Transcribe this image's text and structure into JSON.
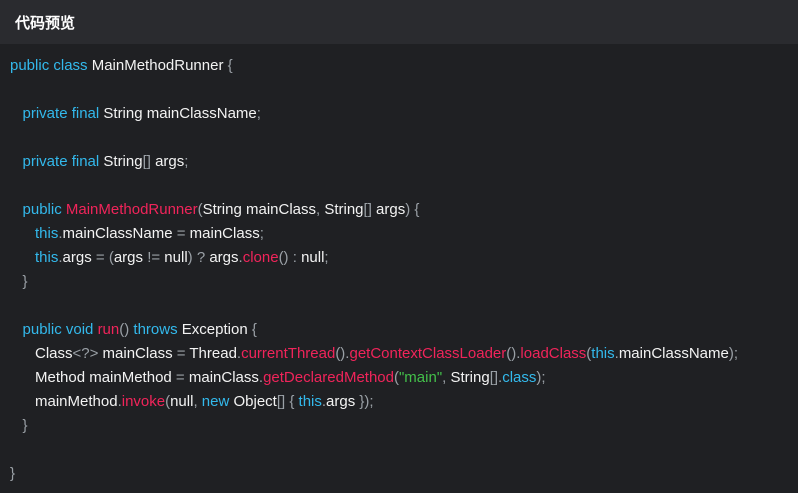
{
  "header": {
    "title": "代码预览"
  },
  "colors": {
    "background": "#1f2023",
    "header_background": "#2a2b2f",
    "keyword": "#33b9ec",
    "function": "#f0245a",
    "string": "#43c04a",
    "punctuation": "#9aa0a6",
    "text": "#f3f3f3"
  },
  "code": {
    "lines": [
      [
        [
          "kw",
          "public class "
        ],
        [
          "tx",
          "MainMethodRunner "
        ],
        [
          "pn",
          "{"
        ]
      ],
      [],
      [
        [
          "tx",
          "   "
        ],
        [
          "kw",
          "private final "
        ],
        [
          "tx",
          "String mainClassName"
        ],
        [
          "pn",
          ";"
        ]
      ],
      [],
      [
        [
          "tx",
          "   "
        ],
        [
          "kw",
          "private final "
        ],
        [
          "tx",
          "String"
        ],
        [
          "pn",
          "[] "
        ],
        [
          "tx",
          "args"
        ],
        [
          "pn",
          ";"
        ]
      ],
      [],
      [
        [
          "tx",
          "   "
        ],
        [
          "kw",
          "public "
        ],
        [
          "fn",
          "MainMethodRunner"
        ],
        [
          "pn",
          "("
        ],
        [
          "tx",
          "String mainClass"
        ],
        [
          "pn",
          ", "
        ],
        [
          "tx",
          "String"
        ],
        [
          "pn",
          "[] "
        ],
        [
          "tx",
          "args"
        ],
        [
          "pn",
          ") {"
        ]
      ],
      [
        [
          "tx",
          "      "
        ],
        [
          "kw",
          "this"
        ],
        [
          "pn",
          "."
        ],
        [
          "tx",
          "mainClassName "
        ],
        [
          "pn",
          "= "
        ],
        [
          "tx",
          "mainClass"
        ],
        [
          "pn",
          ";"
        ]
      ],
      [
        [
          "tx",
          "      "
        ],
        [
          "kw",
          "this"
        ],
        [
          "pn",
          "."
        ],
        [
          "tx",
          "args "
        ],
        [
          "pn",
          "= ("
        ],
        [
          "tx",
          "args "
        ],
        [
          "pn",
          "!= "
        ],
        [
          "tx",
          "null"
        ],
        [
          "pn",
          ") ? "
        ],
        [
          "tx",
          "args"
        ],
        [
          "pn",
          "."
        ],
        [
          "fn",
          "clone"
        ],
        [
          "pn",
          "() : "
        ],
        [
          "tx",
          "null"
        ],
        [
          "pn",
          ";"
        ]
      ],
      [
        [
          "tx",
          "   "
        ],
        [
          "pn",
          "}"
        ]
      ],
      [],
      [
        [
          "tx",
          "   "
        ],
        [
          "kw",
          "public void "
        ],
        [
          "fn",
          "run"
        ],
        [
          "pn",
          "() "
        ],
        [
          "kw",
          "throws "
        ],
        [
          "tx",
          "Exception "
        ],
        [
          "pn",
          "{"
        ]
      ],
      [
        [
          "tx",
          "      Class"
        ],
        [
          "pn",
          "<?> "
        ],
        [
          "tx",
          "mainClass "
        ],
        [
          "pn",
          "= "
        ],
        [
          "tx",
          "Thread"
        ],
        [
          "pn",
          "."
        ],
        [
          "fn",
          "currentThread"
        ],
        [
          "pn",
          "()."
        ],
        [
          "fn",
          "getContextClassLoader"
        ],
        [
          "pn",
          "()."
        ],
        [
          "fn",
          "loadClass"
        ],
        [
          "pn",
          "("
        ],
        [
          "kw",
          "this"
        ],
        [
          "pn",
          "."
        ],
        [
          "tx",
          "mainClassName"
        ],
        [
          "pn",
          ");"
        ]
      ],
      [
        [
          "tx",
          "      Method mainMethod "
        ],
        [
          "pn",
          "= "
        ],
        [
          "tx",
          "mainClass"
        ],
        [
          "pn",
          "."
        ],
        [
          "fn",
          "getDeclaredMethod"
        ],
        [
          "pn",
          "("
        ],
        [
          "str",
          "\"main\""
        ],
        [
          "pn",
          ", "
        ],
        [
          "tx",
          "String"
        ],
        [
          "pn",
          "[]."
        ],
        [
          "kw",
          "class"
        ],
        [
          "pn",
          ");"
        ]
      ],
      [
        [
          "tx",
          "      mainMethod"
        ],
        [
          "pn",
          "."
        ],
        [
          "fn",
          "invoke"
        ],
        [
          "pn",
          "("
        ],
        [
          "tx",
          "null"
        ],
        [
          "pn",
          ", "
        ],
        [
          "kw",
          "new "
        ],
        [
          "tx",
          "Object"
        ],
        [
          "pn",
          "[] { "
        ],
        [
          "kw",
          "this"
        ],
        [
          "pn",
          "."
        ],
        [
          "tx",
          "args "
        ],
        [
          "pn",
          "});"
        ]
      ],
      [
        [
          "tx",
          "   "
        ],
        [
          "pn",
          "}"
        ]
      ],
      [],
      [
        [
          "pn",
          "}"
        ]
      ]
    ]
  }
}
